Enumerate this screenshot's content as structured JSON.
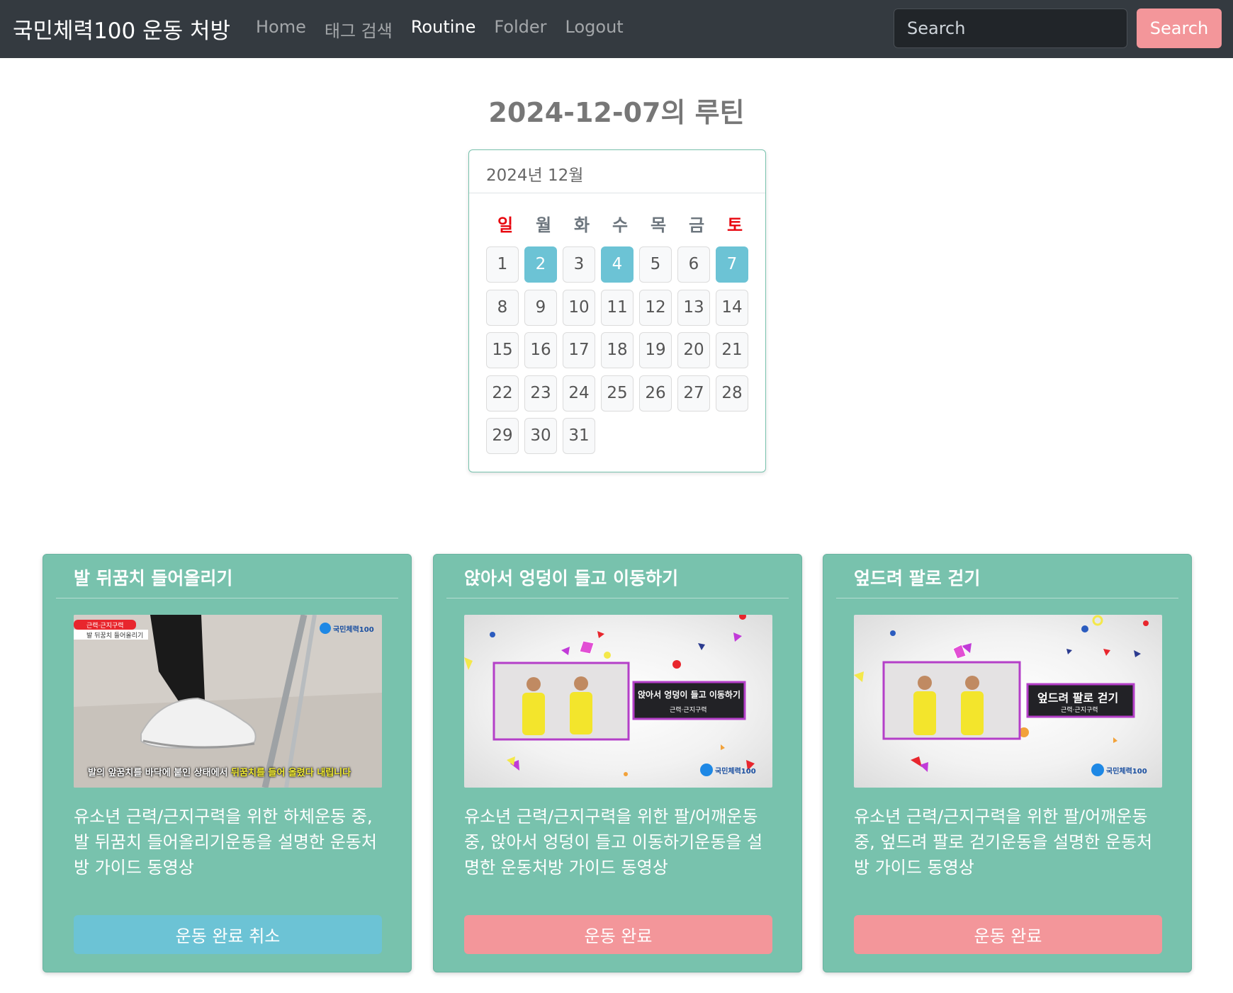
{
  "navbar": {
    "brand": "국민체력100 운동 처방",
    "links": [
      "Home",
      "태그 검색",
      "Routine",
      "Folder",
      "Logout"
    ],
    "active_link": "Routine",
    "search_placeholder": "Search",
    "search_button": "Search"
  },
  "page_title": "2024-12-07의 루틴",
  "calendar": {
    "header": "2024년 12월",
    "weekdays": [
      "일",
      "월",
      "화",
      "수",
      "목",
      "금",
      "토"
    ],
    "weekend_color": "#e8050e",
    "completed_color": "#6cc3d5",
    "days": [
      "1",
      "2",
      "3",
      "4",
      "5",
      "6",
      "7",
      "8",
      "9",
      "10",
      "11",
      "12",
      "13",
      "14",
      "15",
      "16",
      "17",
      "18",
      "19",
      "20",
      "21",
      "22",
      "23",
      "24",
      "25",
      "26",
      "27",
      "28",
      "29",
      "30",
      "31"
    ],
    "completed_days": [
      "2",
      "4",
      "7"
    ]
  },
  "exercises": [
    {
      "title": "발 뒤꿈치 들어올리기",
      "thumb": {
        "tag": "근력·근지구력",
        "subtitle": "발 뒤꿈치 들어올리기",
        "logo": "국민체력100",
        "caption_white": "발의 앞꿈치를 바닥에 붙인 상태에서 ",
        "caption_yellow": "뒤꿈치를 들어 올렸다 내립니다"
      },
      "description": "유소년 근력/근지구력을 위한 하체운동 중, 발 뒤꿈치 들어올리기운동을 설명한 운동처방 가이드 동영상",
      "button": "운동 완료 취소",
      "completed": true
    },
    {
      "title": "앉아서 엉덩이 들고 이동하기",
      "thumb": {
        "label": "앉아서 엉덩이 들고 이동하기",
        "tag": "근력·근지구력",
        "logo": "국민체력100"
      },
      "description": "유소년 근력/근지구력을 위한 팔/어깨운동 중, 앉아서 엉덩이 들고 이동하기운동을 설명한 운동처방 가이드 동영상",
      "button": "운동 완료",
      "completed": false
    },
    {
      "title": "엎드려 팔로 걷기",
      "thumb": {
        "label": "엎드려 팔로 걷기",
        "tag": "근력·근지구력",
        "logo": "국민체력100"
      },
      "description": "유소년 근력/근지구력을 위한 팔/어깨운동 중, 엎드려 팔로 걷기운동을 설명한 운동처방 가이드 동영상",
      "button": "운동 완료",
      "completed": false
    }
  ]
}
